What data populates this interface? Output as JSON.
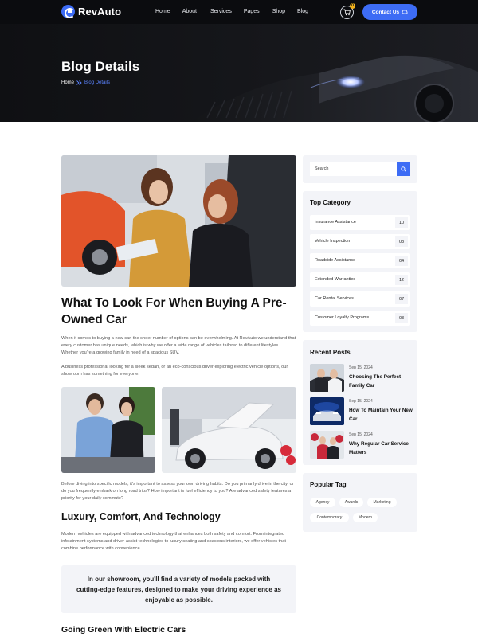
{
  "header": {
    "brand": "RevAuto",
    "nav": [
      "Home",
      "About",
      "Services",
      "Pages",
      "Shop",
      "Blog"
    ],
    "cart_count": "0",
    "contact_label": "Contact Us"
  },
  "hero": {
    "title": "Blog Details",
    "breadcrumb": {
      "home": "Home",
      "current": "Blog Details"
    }
  },
  "article": {
    "title": "What To Look For When Buying A Pre-Owned Car",
    "para1": "When it comes to buying a new car, the sheer number of options can be overwhelming. At RevAuto we understand that every customer has unique needs, which is why we offer a wide range of vehicles tailored to different lifestyles. Whether you're a growing family in need of a spacious SUV,",
    "para2": "A business professional looking for a sleek sedan, or an eco-conscious driver exploring electric vehicle options, our showroom has something for everyone.",
    "para3": "Before diving into specific models, it's important to assess your own driving habits. Do you primarily drive in the city, or do you frequently embark on long road trips? How important is fuel efficiency to you? Are advanced safety features a priority for your daily commute?",
    "heading2": "Luxury, Comfort, And Technology",
    "para4": "Modern vehicles are equipped with advanced technology that enhances both safety and comfort. From integrated infotainment systems and driver-assist technologies to luxury seating and spacious interiors, we offer vehicles that combine performance with convenience.",
    "quote": "In our showroom, you'll find a variety of models packed with cutting-edge features, designed to make your driving experience as enjoyable as possible.",
    "heading3": "Going Green With Electric Cars"
  },
  "sidebar": {
    "search_placeholder": "Search",
    "category_title": "Top Category",
    "categories": [
      {
        "name": "Insurance Assistance",
        "count": "10"
      },
      {
        "name": "Vehicle Inspection",
        "count": "08"
      },
      {
        "name": "Roadside Assistance",
        "count": "04"
      },
      {
        "name": "Extended Warranties",
        "count": "12"
      },
      {
        "name": "Car Rental Services",
        "count": "07"
      },
      {
        "name": "Customer Loyalty Programs",
        "count": "03"
      }
    ],
    "recent_title": "Recent Posts",
    "posts": [
      {
        "date": "Sep 15, 2024",
        "title": "Choosing The Perfect Family Car"
      },
      {
        "date": "Sep 15, 2024",
        "title": "How To Maintain Your New Car"
      },
      {
        "date": "Sep 15, 2024",
        "title": "Why Regular Car Service Matters"
      }
    ],
    "tags_title": "Popular Tag",
    "tags": [
      "Agency",
      "Awards",
      "Marketing",
      "Contemporary",
      "Modern"
    ]
  },
  "colors": {
    "accent": "#3d6cf5",
    "dark": "#0b0c0f",
    "panel": "#f3f4f8"
  }
}
